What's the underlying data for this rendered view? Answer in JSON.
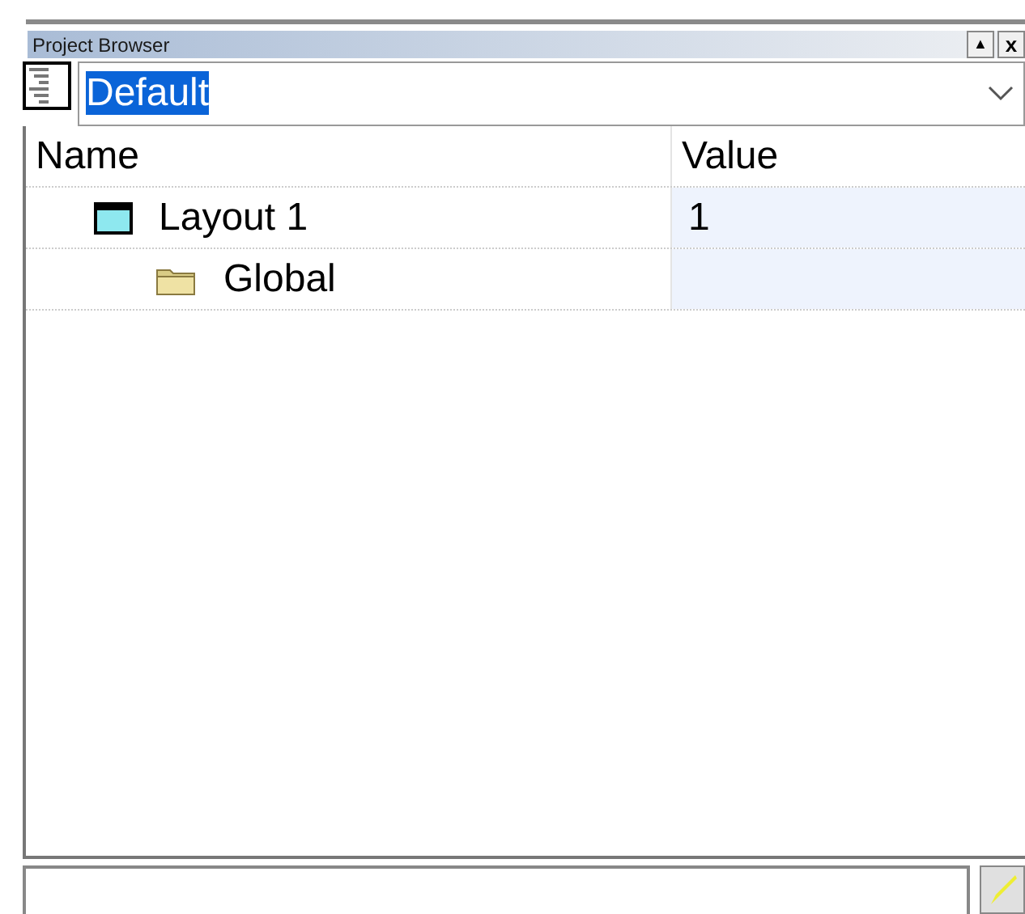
{
  "panel": {
    "title": "Project Browser"
  },
  "title_buttons": [
    {
      "kind": "up",
      "label": "▲"
    },
    {
      "kind": "close",
      "label": "x"
    }
  ],
  "view_selector": {
    "value": "Default",
    "text_selected": true
  },
  "table": {
    "columns": [
      "Name",
      "Value"
    ],
    "rows": [
      {
        "name": "Layout 1",
        "kind": "layout",
        "value": "1",
        "children": [
          {
            "name": "Global",
            "kind": "folder"
          }
        ]
      }
    ]
  }
}
